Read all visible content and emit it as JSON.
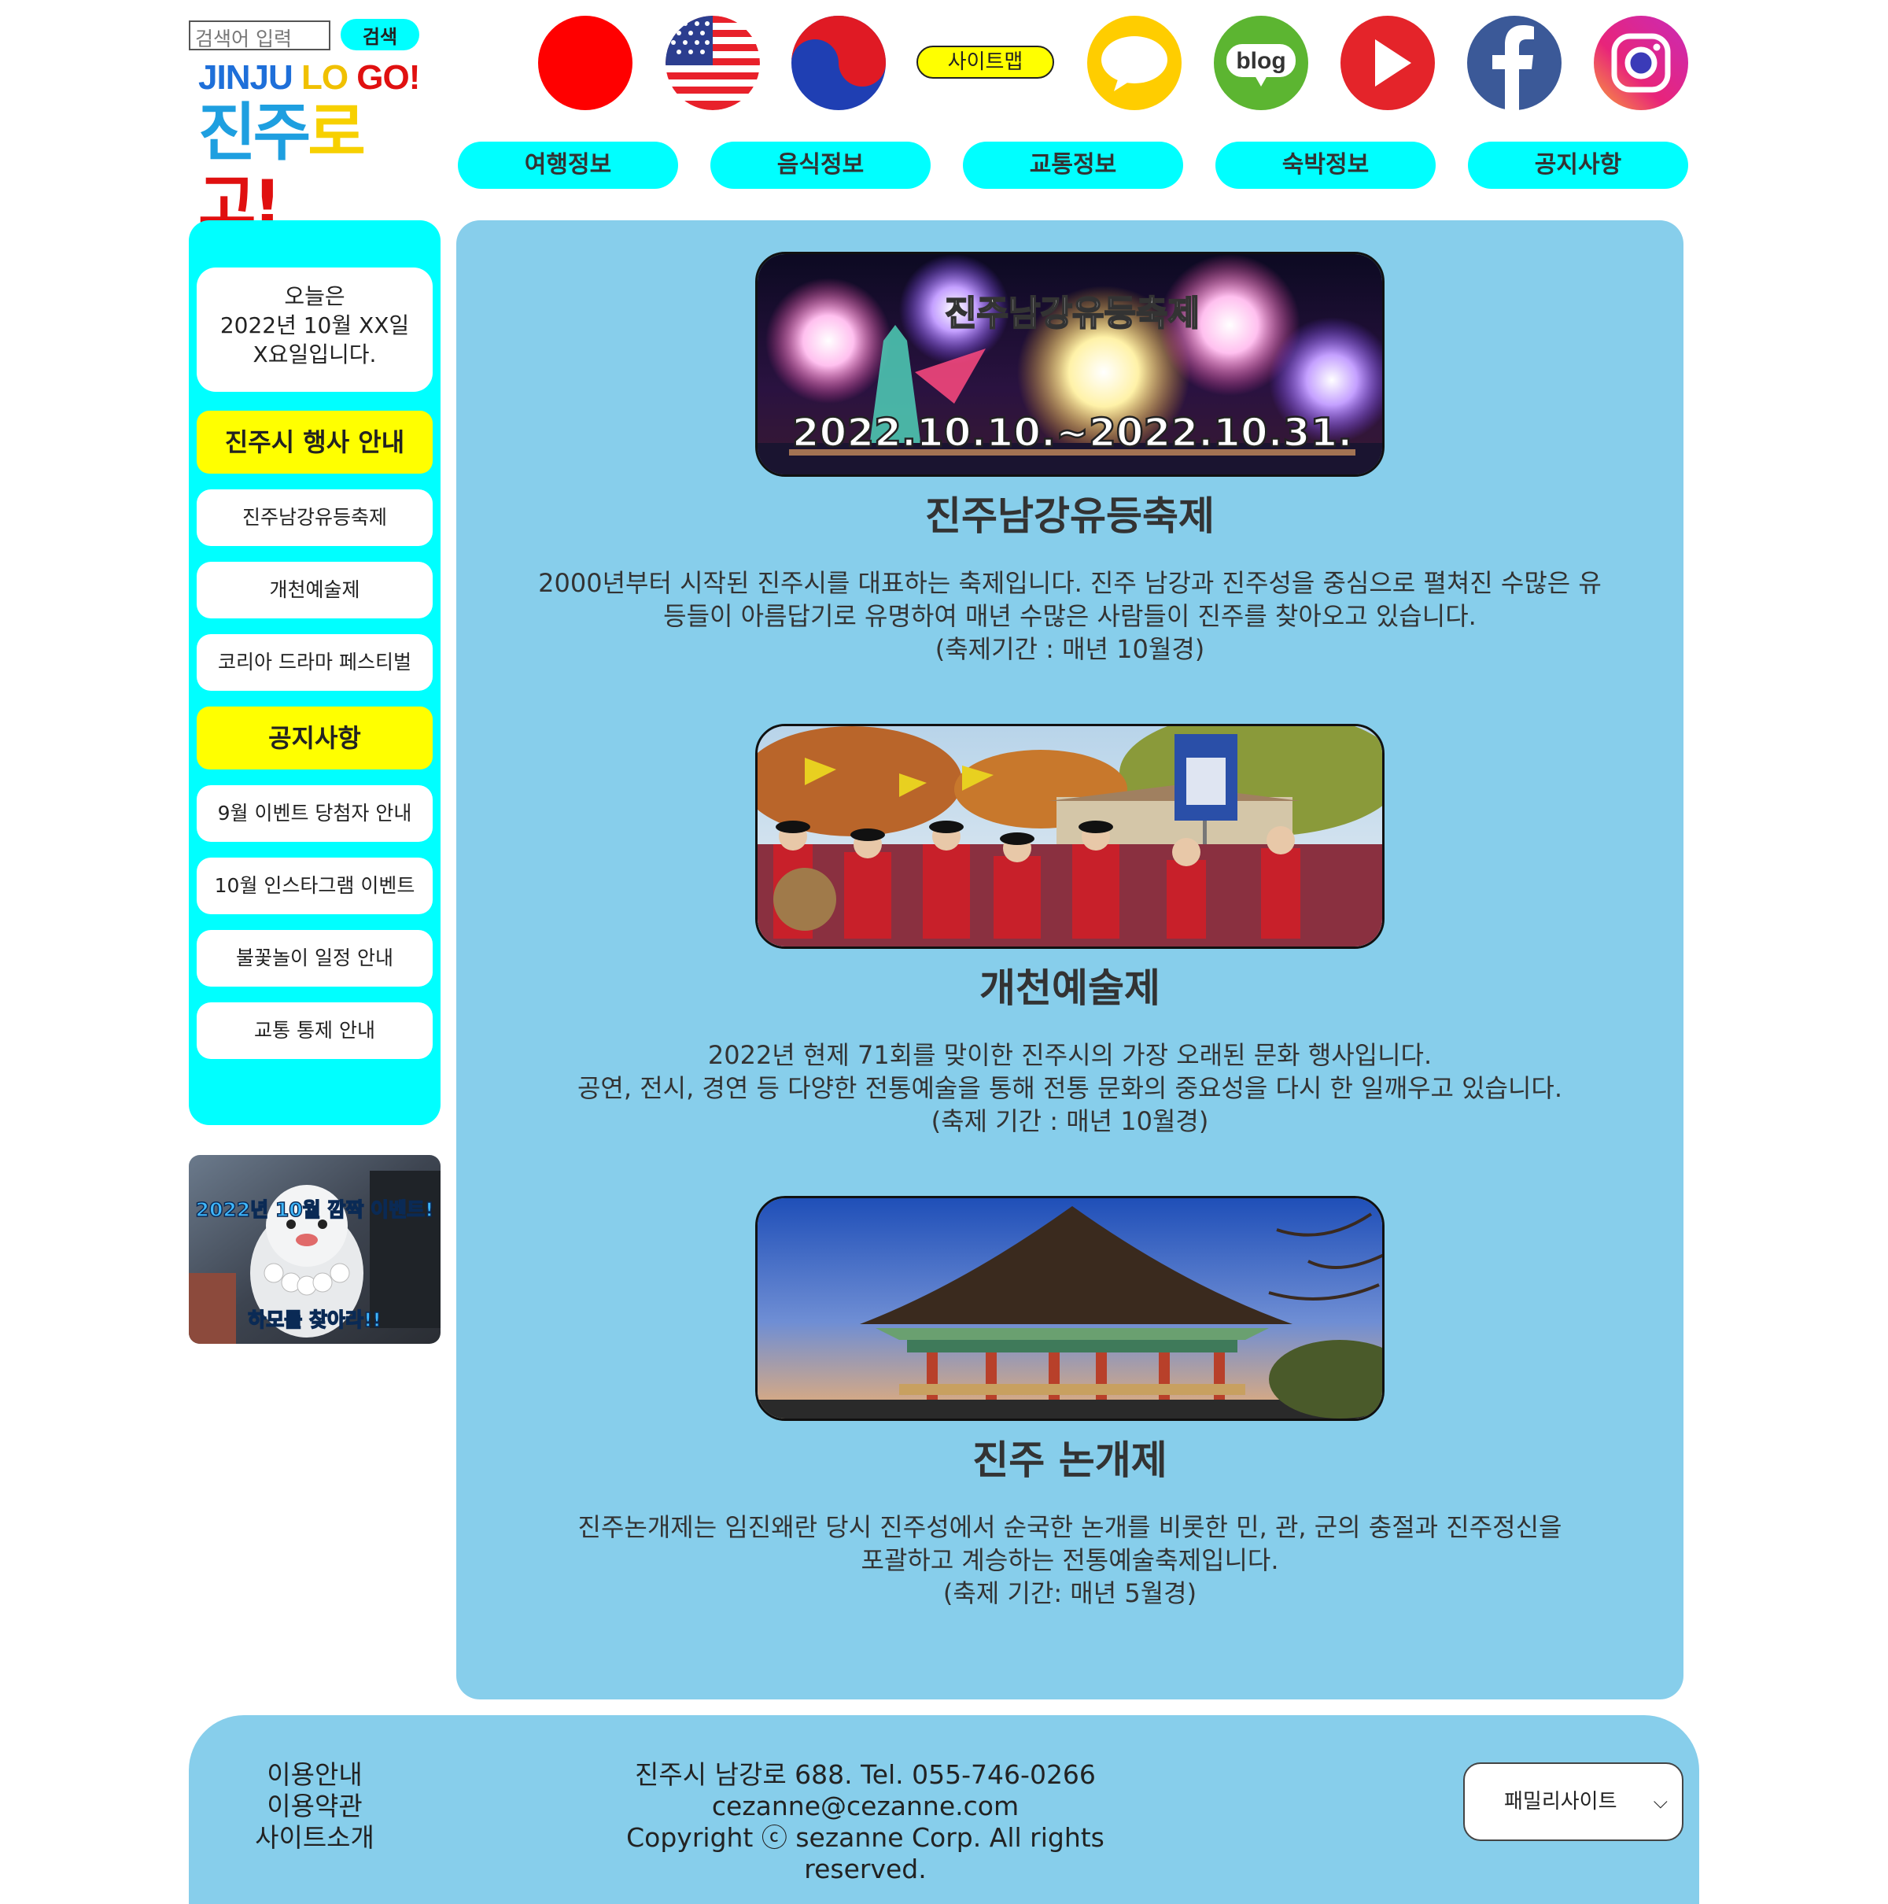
{
  "header": {
    "search_placeholder": "검색어 입력",
    "search_button": "검색",
    "logo_en_part1": "JINJU",
    "logo_en_part2": "LO",
    "logo_en_part3": "GO!",
    "logo_ko_part1": "진주",
    "logo_ko_part2": "로",
    "logo_ko_part3": "고!",
    "sitemap_label": "사이트맵",
    "blog_label": "blog",
    "icons": [
      "japan-flag-icon",
      "usa-flag-icon",
      "korea-flag-icon",
      "kakaotalk-icon",
      "blog-icon",
      "youtube-icon",
      "facebook-icon",
      "instagram-icon"
    ]
  },
  "nav": [
    "여행정보",
    "음식정보",
    "교통정보",
    "숙박정보",
    "공지사항"
  ],
  "sidebar": {
    "date_line1": "오늘은",
    "date_line2": "2022년 10월 XX일",
    "date_line3": "X요일입니다.",
    "events_head": "진주시 행사 안내",
    "events": [
      "진주남강유등축제",
      "개천예술제",
      "코리아 드라마 페스티벌"
    ],
    "notice_head": "공지사항",
    "notices": [
      "9월 이벤트 당첨자 안내",
      "10월 인스타그램 이벤트",
      "불꽃놀이 일정 안내",
      "교통 통제 안내"
    ],
    "banner_line1": "2022년 10월 깜짝 이벤트!",
    "banner_line2": "하모를 찾아라!!"
  },
  "festivals": [
    {
      "image_title": "진주남강유등축제",
      "image_dates": "2022.10.10.~2022.10.31.",
      "title": "진주남강유등축제",
      "desc1": "2000년부터 시작된 진주시를 대표하는 축제입니다. 진주 남강과 진주성을 중심으로 펼쳐진 수많은 유",
      "desc2": "등들이 아름답기로 유명하여 매년 수많은 사람들이 진주를 찾아오고 있습니다.",
      "desc3": "(축제기간 : 매년 10월경)"
    },
    {
      "title": "개천예술제",
      "desc1": "2022년 현제 71회를 맞이한 진주시의 가장 오래된 문화 행사입니다.",
      "desc2": "공연, 전시, 경연 등 다양한 전통예술을 통해 전통 문화의 중요성을 다시 한 일깨우고 있습니다.",
      "desc3": "(축제 기간 : 매년 10월경)"
    },
    {
      "title": "진주 논개제",
      "desc1": "진주논개제는 임진왜란 당시 진주성에서 순국한 논개를 비롯한 민, 관, 군의 충절과 진주정신을",
      "desc2": "포괄하고 계승하는 전통예술축제입니다.",
      "desc3": "(축제 기간: 매년 5월경)"
    }
  ],
  "footer": {
    "links": [
      "이용안내",
      "이용약관",
      "사이트소개"
    ],
    "address": "진주시 남강로 688. Tel. 055-746-0266",
    "email": "cezanne@cezanne.com",
    "copyright": "Copyright ⓒ sezanne Corp. All rights reserved.",
    "family_site": "패밀리사이트"
  },
  "colors": {
    "cyan": "#00ffff",
    "yellow": "#ffff00",
    "sky": "#87ceeb"
  }
}
